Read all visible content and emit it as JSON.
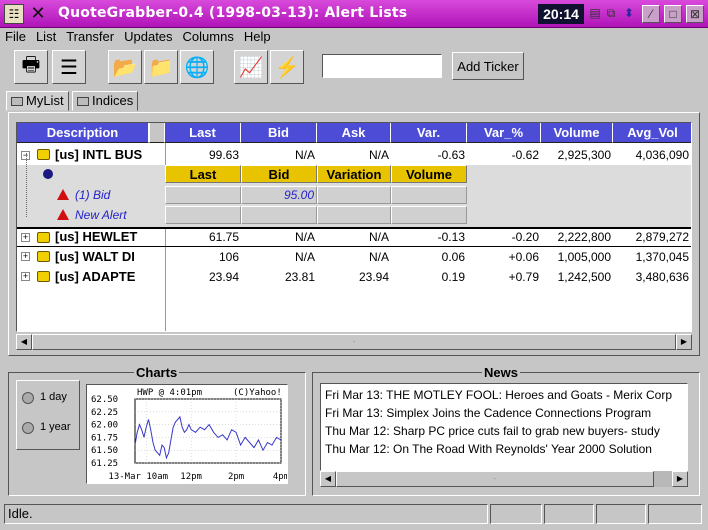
{
  "window": {
    "title": "QuoteGrabber-0.4 (1998-03-13): Alert Lists",
    "clock": "20:14"
  },
  "menu": [
    "File",
    "List",
    "Transfer",
    "Updates",
    "Columns",
    "Help"
  ],
  "toolbar": {
    "icons": [
      "printer-icon",
      "list-icon",
      "folder-open-icon",
      "folder-icon",
      "global-icon",
      "chart-icon",
      "lightning-icon"
    ],
    "ticker_value": "",
    "add_ticker_label": "Add Ticker"
  },
  "tabs": [
    {
      "label": "MyList",
      "active": true
    },
    {
      "label": "Indices",
      "active": false
    }
  ],
  "table": {
    "columns": [
      "Description",
      "Last",
      "Bid",
      "Ask",
      "Var.",
      "Var_%",
      "Volume",
      "Avg_Vol"
    ],
    "rows": [
      {
        "desc": "[us] INTL BUS",
        "last": "99.63",
        "bid": "N/A",
        "ask": "N/A",
        "var": "-0.63",
        "var_pct": "-0.62",
        "volume": "2,925,300",
        "avg_vol": "4,036,090",
        "expanded": true
      },
      {
        "desc": "[us] HEWLET",
        "last": "61.75",
        "bid": "N/A",
        "ask": "N/A",
        "var": "-0.13",
        "var_pct": "-0.20",
        "volume": "2,222,800",
        "avg_vol": "2,879,272",
        "expanded": false
      },
      {
        "desc": "[us] WALT DI",
        "last": "106",
        "bid": "N/A",
        "ask": "N/A",
        "var": "0.06",
        "var_pct": "+0.06",
        "volume": "1,005,000",
        "avg_vol": "1,370,045",
        "expanded": false
      },
      {
        "desc": "[us] ADAPTE",
        "last": "23.94",
        "bid": "23.81",
        "ask": "23.94",
        "var": "0.19",
        "var_pct": "+0.79",
        "volume": "1,242,500",
        "avg_vol": "3,480,636",
        "expanded": false
      }
    ],
    "alert_columns": [
      "Last",
      "Bid",
      "Variation",
      "Volume"
    ],
    "alerts": [
      {
        "label": "(1) Bid",
        "bid": "95.00"
      },
      {
        "label": "New Alert",
        "bid": ""
      }
    ]
  },
  "charts": {
    "title": "Charts",
    "ranges": [
      "1 day",
      "1 year"
    ],
    "chart_header": "HWP @ 4:01pm",
    "chart_source": "(C)Yahoo!"
  },
  "chart_data": {
    "type": "line",
    "title": "HWP @ 4:01pm",
    "x_ticks": [
      "13-Mar 10am",
      "12pm",
      "2pm",
      "4pm"
    ],
    "y_ticks": [
      62.5,
      62.25,
      62.0,
      61.75,
      61.5,
      61.25
    ],
    "ylim": [
      61.25,
      62.5
    ],
    "xlim": [
      9.5,
      16
    ],
    "grid": true,
    "series": [
      {
        "x": [
          9.5,
          9.6,
          9.7,
          9.8,
          9.9,
          10.0,
          10.1,
          10.2,
          10.3,
          10.4,
          10.5,
          10.6,
          10.7,
          10.8,
          10.9,
          11.0,
          11.1,
          11.2,
          11.3,
          11.4,
          11.5,
          11.6,
          11.7,
          11.8,
          11.9,
          12.0,
          12.2,
          12.4,
          12.6,
          12.8,
          13.0,
          13.2,
          13.4,
          13.6,
          13.8,
          14.0,
          14.2,
          14.4,
          14.6,
          14.8,
          15.0,
          15.2,
          15.4,
          15.6,
          15.8,
          16.0
        ],
        "values": [
          61.6,
          61.85,
          62.0,
          61.9,
          61.75,
          61.95,
          62.1,
          61.9,
          61.65,
          61.5,
          61.45,
          61.4,
          61.6,
          61.55,
          61.35,
          61.45,
          61.7,
          61.95,
          62.05,
          62.1,
          62.15,
          61.95,
          61.85,
          61.9,
          62.0,
          61.9,
          61.85,
          61.95,
          61.9,
          62.0,
          61.85,
          61.75,
          61.8,
          61.7,
          61.9,
          61.85,
          61.6,
          61.75,
          61.65,
          61.55,
          61.7,
          61.5,
          61.65,
          61.6,
          61.75,
          61.7
        ]
      }
    ]
  },
  "news": {
    "title": "News",
    "items": [
      "Fri Mar 13: THE MOTLEY FOOL: Heroes and Goats - Merix Corp",
      "Fri Mar 13: Simplex Joins the Cadence Connections Program",
      "Thu Mar 12: Sharp PC price cuts fail to grab new buyers- study",
      "Thu Mar 12: On The Road With Reynolds' Year 2000 Solution"
    ]
  },
  "status": {
    "text": "Idle."
  }
}
